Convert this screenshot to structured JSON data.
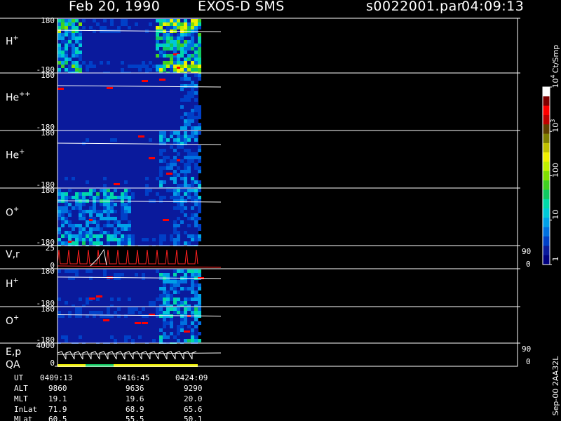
{
  "header": {
    "date": "Feb 20, 1990",
    "instrument": "EXOS-D SMS",
    "file": "s0022001.par",
    "time": "04:09:13"
  },
  "chart_data": {
    "type": "heatmap",
    "title": "Feb 20, 1990   EXOS-D SMS",
    "panels": [
      {
        "name": "H",
        "sup": "+",
        "ymax": "180",
        "ymin": "-180",
        "kind": "spectrogram"
      },
      {
        "name": "He",
        "sup": "++",
        "ymax": "180",
        "ymin": "-180",
        "kind": "spectrogram"
      },
      {
        "name": "He",
        "sup": "+",
        "ymax": "180",
        "ymin": "-180",
        "kind": "spectrogram"
      },
      {
        "name": "O",
        "sup": "+",
        "ymax": "180",
        "ymin": "-180",
        "kind": "spectrogram"
      },
      {
        "name": "V,r",
        "sup": "",
        "ymax": "25",
        "ymin": "0",
        "right_max": "90",
        "right_min": "0",
        "kind": "line"
      },
      {
        "name": "H",
        "sup": "+",
        "ymax": "180",
        "ymin": "-180",
        "kind": "spectrogram"
      },
      {
        "name": "O",
        "sup": "+",
        "ymax": "180",
        "ymin": "-180",
        "kind": "spectrogram"
      },
      {
        "name": "E,p",
        "name2": "QA",
        "sup": "",
        "ymax": "4000",
        "ymin": "0",
        "right_max": "90",
        "right_min": "0",
        "kind": "line"
      }
    ],
    "colorbar": {
      "unit": "Ct/Smp",
      "ticks": [
        {
          "label": "1",
          "value": 1
        },
        {
          "label": "10",
          "value": 10
        },
        {
          "label": "100",
          "value": 100
        },
        {
          "label": "10",
          "sup": "3",
          "value": 1000
        },
        {
          "label": "10",
          "sup": "4",
          "value": 10000
        }
      ],
      "colors": [
        "#000080",
        "#0a1a9c",
        "#0040c8",
        "#0070e0",
        "#00a0e8",
        "#00c8d8",
        "#00d8a8",
        "#10c860",
        "#40d020",
        "#80e000",
        "#c0f000",
        "#f0f000",
        "#c0c000",
        "#808000",
        "#604000",
        "#c00000",
        "#ff0000",
        "#800000",
        "#ffffff"
      ]
    },
    "footer": {
      "labels": [
        "UT",
        "ALT",
        "MLT",
        "InLat",
        "MLat"
      ],
      "columns": [
        [
          "0409:13",
          "9860",
          "19.1",
          "71.9",
          "60.5"
        ],
        [
          "0416:45",
          "9636",
          "19.6",
          "68.9",
          "55.5"
        ],
        [
          "0424:09",
          "9290",
          "20.0",
          "65.6",
          "50.1"
        ]
      ]
    },
    "side_label": "Sep-00 2AA32L"
  }
}
